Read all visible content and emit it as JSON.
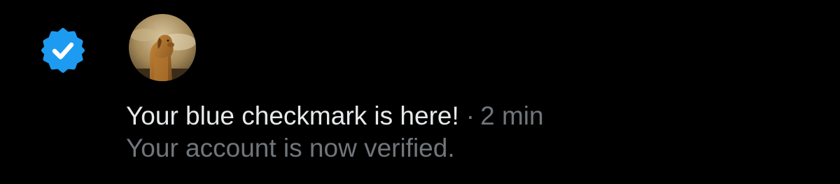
{
  "notification": {
    "title": "Your blue checkmark is here!",
    "separator": "·",
    "time": "2 min",
    "body": "Your account is now verified."
  },
  "icons": {
    "badge": "verified-badge-icon",
    "avatar": "golden-retriever-avatar"
  },
  "colors": {
    "background": "#000000",
    "badge_blue": "#1d9bf0",
    "primary_text": "#e7e9ea",
    "secondary_text": "#71767b"
  }
}
